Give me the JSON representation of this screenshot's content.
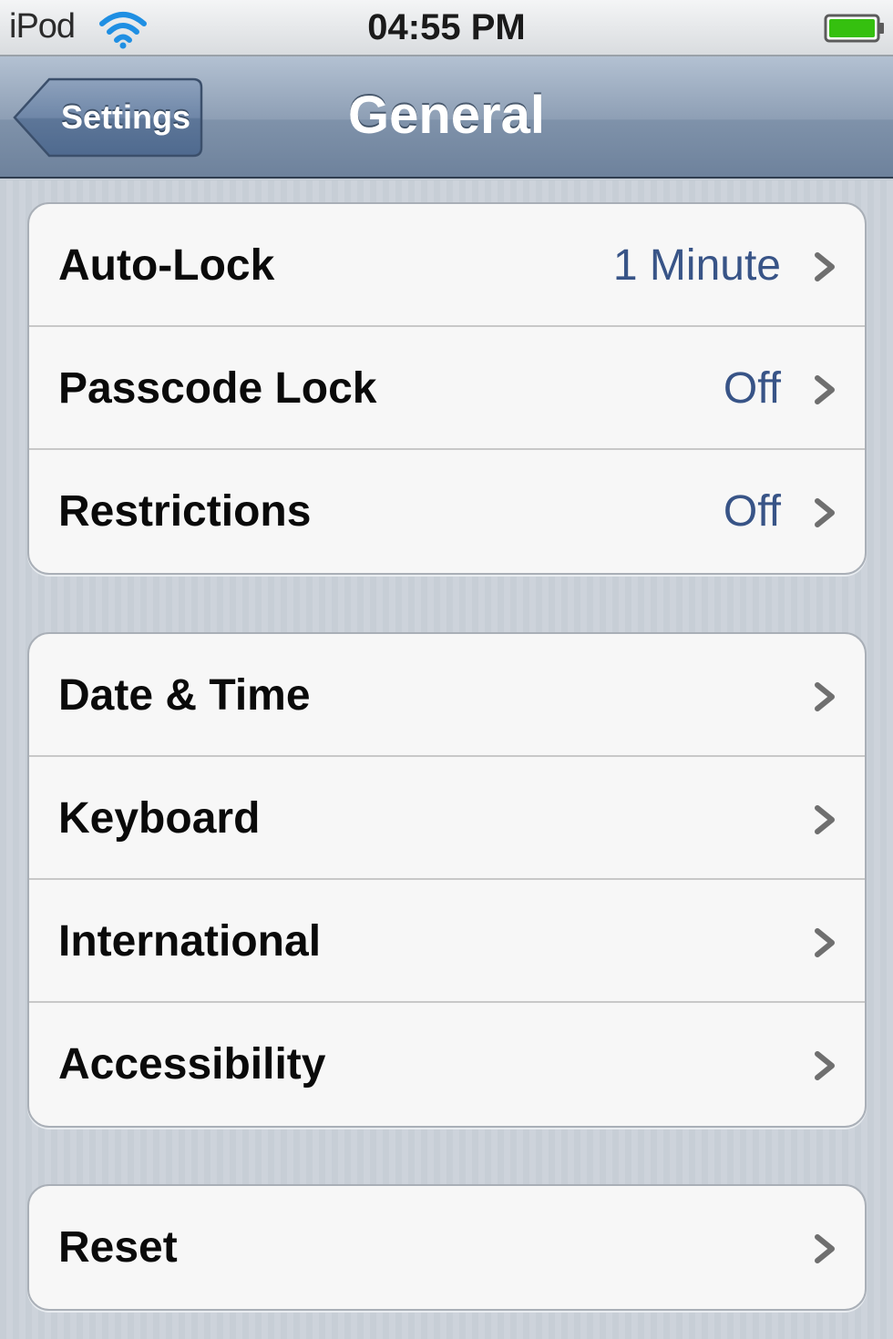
{
  "status_bar": {
    "carrier": "iPod",
    "time": "04:55 PM",
    "wifi_icon": "wifi-icon",
    "battery_icon": "battery-icon",
    "battery_level": 1.0,
    "battery_color": "#35c00f"
  },
  "nav_bar": {
    "back_label": "Settings",
    "title": "General",
    "color": "#8e9fb5"
  },
  "groups": [
    {
      "rows": [
        {
          "label": "Auto-Lock",
          "value": "1 Minute"
        },
        {
          "label": "Passcode Lock",
          "value": "Off"
        },
        {
          "label": "Restrictions",
          "value": "Off"
        }
      ]
    },
    {
      "rows": [
        {
          "label": "Date & Time"
        },
        {
          "label": "Keyboard"
        },
        {
          "label": "International"
        },
        {
          "label": "Accessibility"
        }
      ]
    },
    {
      "rows": [
        {
          "label": "Reset"
        }
      ]
    }
  ],
  "icons": {
    "row_disclosure": "chevron-right-icon"
  },
  "colors": {
    "value_text": "#385487",
    "cell_background": "#f7f7f7",
    "page_background": "#c7ced6"
  }
}
